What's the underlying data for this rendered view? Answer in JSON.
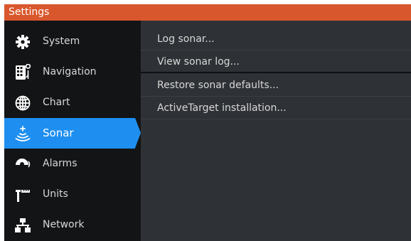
{
  "window": {
    "title": "Settings"
  },
  "colors": {
    "title_bar": "#d9572c",
    "selected": "#1e8ff0",
    "sidebar_bg": "#131416",
    "content_bg": "#2e3135"
  },
  "sidebar": {
    "items": [
      {
        "label": "System",
        "icon": "gear-icon"
      },
      {
        "label": "Navigation",
        "icon": "navigation-icon"
      },
      {
        "label": "Chart",
        "icon": "globe-icon"
      },
      {
        "label": "Sonar",
        "icon": "sonar-icon",
        "selected": true
      },
      {
        "label": "Alarms",
        "icon": "alarm-icon"
      },
      {
        "label": "Units",
        "icon": "units-icon"
      },
      {
        "label": "Network",
        "icon": "network-icon"
      }
    ]
  },
  "content": {
    "items": [
      {
        "label": "Log sonar..."
      },
      {
        "label": "View sonar log..."
      },
      {
        "label": "Restore sonar defaults..."
      },
      {
        "label": "ActiveTarget installation..."
      }
    ]
  }
}
